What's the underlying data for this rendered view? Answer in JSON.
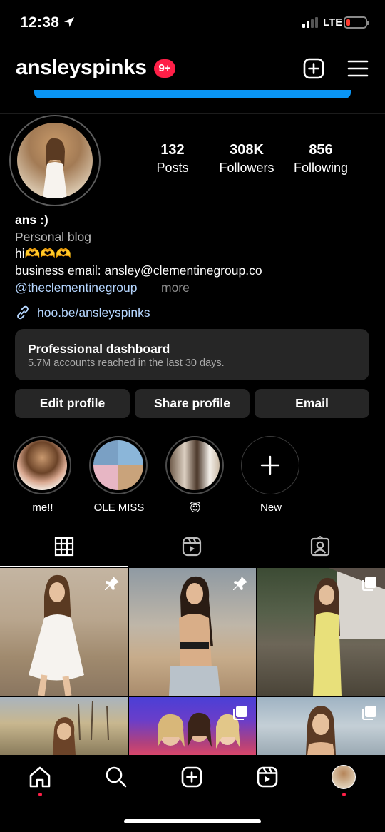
{
  "status_bar": {
    "time": "12:38",
    "network": "LTE",
    "signal_bars": 2,
    "battery_percent": 10,
    "battery_color": "#ff3b30"
  },
  "header": {
    "username": "ansleyspinks",
    "notification_badge": "9+",
    "badge_color": "#ff1f47",
    "create_icon": "plus-square-icon",
    "menu_icon": "hamburger-menu-icon",
    "upload_progress_percent": 100,
    "progress_color": "#0a95f5"
  },
  "profile": {
    "stats": [
      {
        "value": "132",
        "label": "Posts"
      },
      {
        "value": "308K",
        "label": "Followers"
      },
      {
        "value": "856",
        "label": "Following"
      }
    ],
    "name": "ans :)",
    "category": "Personal blog",
    "bio_line1": "hi🫶🫶🫶",
    "bio_line2": "business email: ansley@clementinegroup.co",
    "bio_mention": "@theclementinegroup",
    "more": "more",
    "link": "hoo.be/ansleyspinks",
    "link_icon": "link-icon"
  },
  "dashboard": {
    "title": "Professional dashboard",
    "subtitle": "5.7M accounts reached in the last 30 days."
  },
  "actions": {
    "edit": "Edit profile",
    "share": "Share profile",
    "email": "Email"
  },
  "highlights": [
    {
      "label": "me!!"
    },
    {
      "label": "OLE MISS"
    },
    {
      "label": "😇"
    },
    {
      "label": "New"
    }
  ],
  "tabs": [
    "grid-icon",
    "reels-icon",
    "tagged-icon"
  ],
  "grid_badges": [
    "pin-icon",
    "pin-icon",
    "carousel-icon",
    "",
    "carousel-icon",
    "carousel-icon"
  ],
  "bottom_nav": [
    "home-icon",
    "search-icon",
    "create-icon",
    "reels-icon",
    "profile-avatar"
  ]
}
